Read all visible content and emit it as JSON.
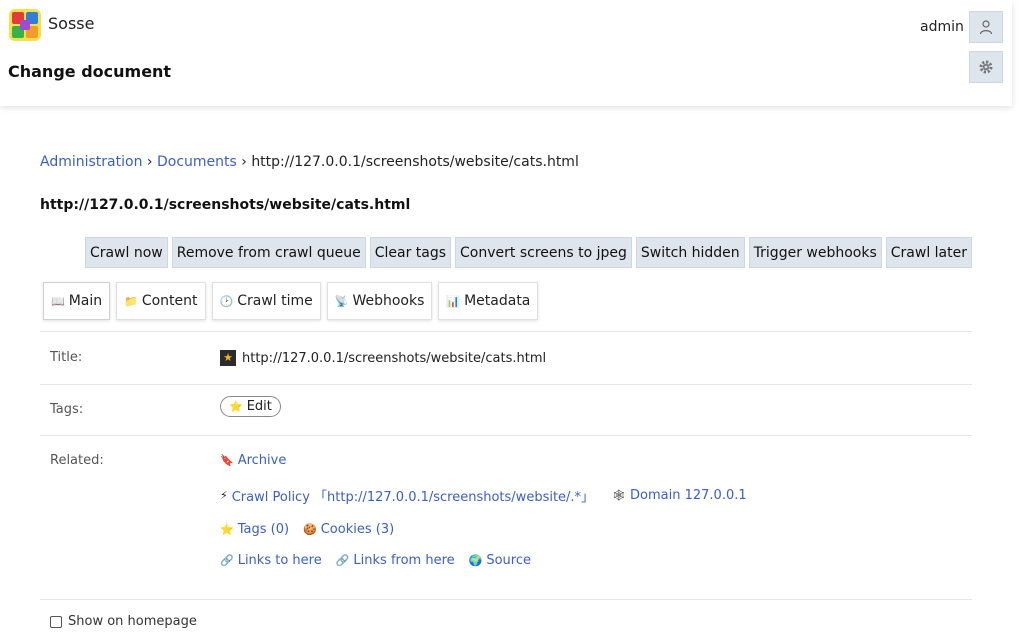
{
  "header": {
    "app_name": "Sosse",
    "page_title": "Change document",
    "username": "admin",
    "user_icon": "user-icon",
    "settings_icon": "gear-icon"
  },
  "breadcrumb": {
    "items": [
      "Administration",
      "Documents"
    ],
    "separator": "›",
    "current": "http://127.0.0.1/screenshots/website/cats.html"
  },
  "document": {
    "heading": "http://127.0.0.1/screenshots/website/cats.html"
  },
  "actions": [
    "Crawl now",
    "Remove from crawl queue",
    "Clear tags",
    "Convert screens to jpeg",
    "Switch hidden",
    "Trigger webhooks",
    "Crawl later"
  ],
  "tabs": [
    {
      "icon": "📖",
      "label": "Main"
    },
    {
      "icon": "📁",
      "label": "Content"
    },
    {
      "icon": "🕑",
      "label": "Crawl time"
    },
    {
      "icon": "📡",
      "label": "Webhooks"
    },
    {
      "icon": "📊",
      "label": "Metadata"
    }
  ],
  "fields": {
    "title_label": "Title:",
    "title_value": "http://127.0.0.1/screenshots/website/cats.html",
    "tags_label": "Tags:",
    "edit_label": "Edit",
    "related_label": "Related:"
  },
  "related": {
    "archive": {
      "icon": "🔖",
      "label": "Archive"
    },
    "crawl_policy": {
      "icon": "⚡",
      "label": "Crawl Policy 「http://127.0.0.1/screenshots/website/.*」"
    },
    "domain": {
      "icon": "🕸",
      "label": "Domain 127.0.0.1"
    },
    "tags": {
      "icon": "⭐",
      "label": "Tags (0)"
    },
    "cookies": {
      "icon": "🍪",
      "label": "Cookies (3)"
    },
    "links_to": {
      "icon": "🔗",
      "label": "Links to here"
    },
    "links_from": {
      "icon": "🔗",
      "label": "Links from here"
    },
    "source": {
      "icon": "🌍",
      "label": "Source"
    }
  },
  "show_on_homepage": {
    "label": "Show on homepage",
    "checked": false
  },
  "colors": {
    "link": "#3a5fc4",
    "button_bg": "#dfe5ec"
  }
}
